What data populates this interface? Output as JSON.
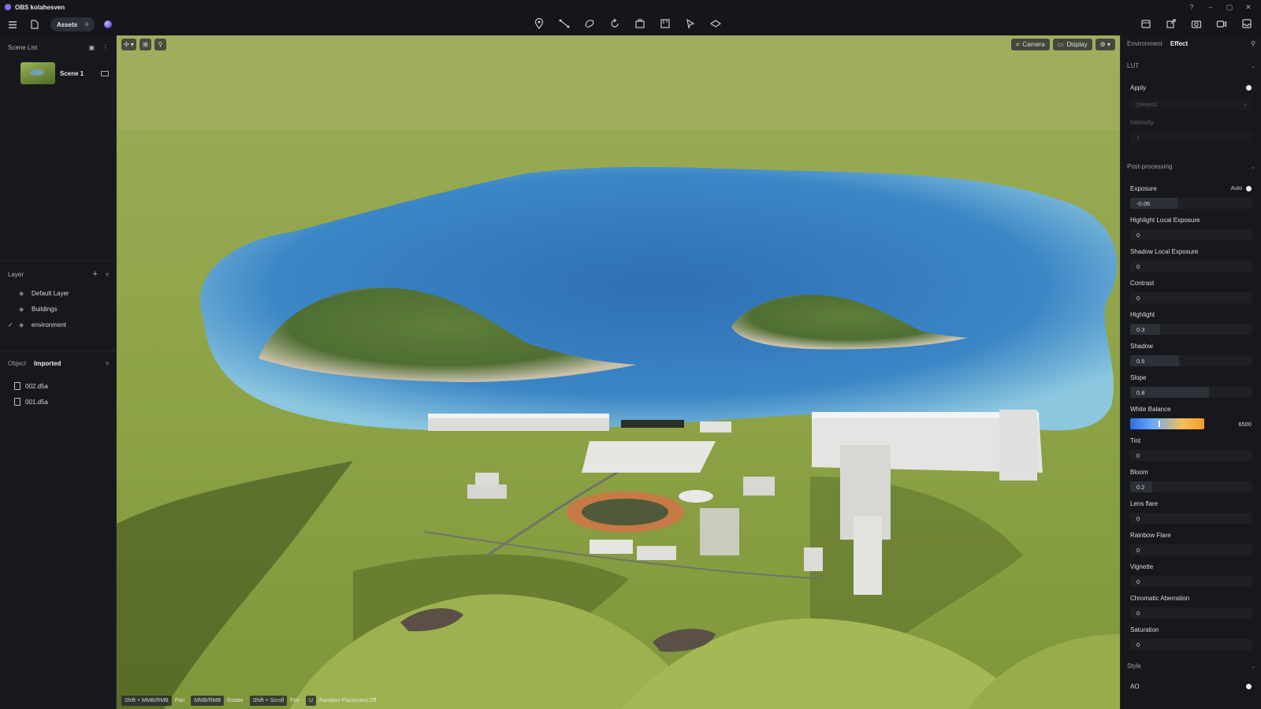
{
  "app": {
    "title": "OBS kolahesven"
  },
  "toolbar": {
    "assets_label": "Assets",
    "center_icons": [
      "pin-icon",
      "path-icon",
      "lasso-icon",
      "rotate-icon",
      "object-icon",
      "measure-icon",
      "select-icon",
      "layers-icon"
    ],
    "right_icons": [
      "render-icon",
      "share-icon",
      "camera-icon",
      "video-icon",
      "export-icon"
    ]
  },
  "sidebar": {
    "scene_list_title": "Scene List",
    "scenes": [
      {
        "name": "Scene 1"
      }
    ],
    "layer_title": "Layer",
    "layers": [
      {
        "name": "Default Layer",
        "checked": false
      },
      {
        "name": "Buildings",
        "checked": false
      },
      {
        "name": "environment",
        "checked": true
      }
    ],
    "object_tabs": [
      {
        "label": "Object",
        "active": false
      },
      {
        "label": "Imported",
        "active": true
      }
    ],
    "files": [
      {
        "name": "002.d5a"
      },
      {
        "name": "001.d5a"
      }
    ]
  },
  "viewport": {
    "camera_label": "Camera",
    "display_label": "Display",
    "hints": [
      {
        "key": "Shift + MMB/RMB",
        "desc": "Pan"
      },
      {
        "key": "MMB/RMB",
        "desc": "Rotate"
      },
      {
        "key": "Shift + Scroll",
        "desc": "Fov"
      },
      {
        "key": "U",
        "desc": "Random Placement Off"
      }
    ]
  },
  "panel": {
    "tabs": [
      {
        "label": "Environment",
        "active": false
      },
      {
        "label": "Effect",
        "active": true
      }
    ],
    "lut": {
      "title": "LUT",
      "apply_label": "Apply",
      "apply_on": true,
      "preset": "Desert2",
      "intensity_label": "Intensity",
      "intensity_value": "1"
    },
    "post": {
      "title": "Post-processing",
      "exposure_label": "Exposure",
      "auto_label": "Auto",
      "exposure_value": "-0.06",
      "highlight_local_label": "Highlight Local Exposure",
      "highlight_local_value": "0",
      "shadow_local_label": "Shadow Local Exposure",
      "shadow_local_value": "0",
      "contrast_label": "Contrast",
      "contrast_value": "0",
      "highlight_label": "Highlight",
      "highlight_value": "0.3",
      "shadow_label": "Shadow",
      "shadow_value": "0.5",
      "slope_label": "Slope",
      "slope_value": "0.8",
      "white_balance_label": "White Balance",
      "white_balance_value": "6500",
      "tint_label": "Tint",
      "tint_value": "0",
      "bloom_label": "Bloom",
      "bloom_value": "0.2",
      "lens_flare_label": "Lens flare",
      "lens_flare_value": "0",
      "rainbow_flare_label": "Rainbow Flare",
      "rainbow_flare_value": "0",
      "vignette_label": "Vignette",
      "vignette_value": "0",
      "chromatic_label": "Chromatic Aberration",
      "chromatic_value": "0",
      "saturation_label": "Saturation",
      "saturation_value": "0"
    },
    "style": {
      "title": "Style",
      "ao_label": "AO",
      "ao_on": true
    }
  },
  "colors": {
    "accent": "#8b6cf0",
    "panel_bg": "#17181d",
    "water": "#3f86c4",
    "grass": "#8fa64a"
  }
}
